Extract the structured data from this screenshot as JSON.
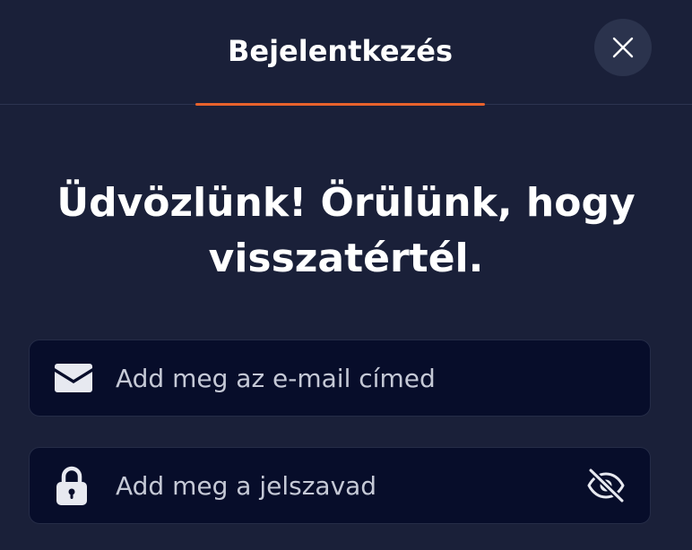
{
  "header": {
    "tab_label": "Bejelentkezés",
    "accent_color": "#e8622c"
  },
  "welcome": {
    "line1": "Üdvözlünk! Örülünk, hogy",
    "line2": "visszatértél."
  },
  "form": {
    "email": {
      "value": "",
      "placeholder": "Add meg az e-mail címed",
      "icon": "envelope-icon"
    },
    "password": {
      "value": "",
      "placeholder": "Add meg a jelszavad",
      "icon": "lock-icon",
      "toggle_icon": "eye-slash-icon"
    }
  },
  "colors": {
    "background": "#1a2039",
    "input_background": "#070d2a",
    "close_button_background": "#2b334d"
  }
}
